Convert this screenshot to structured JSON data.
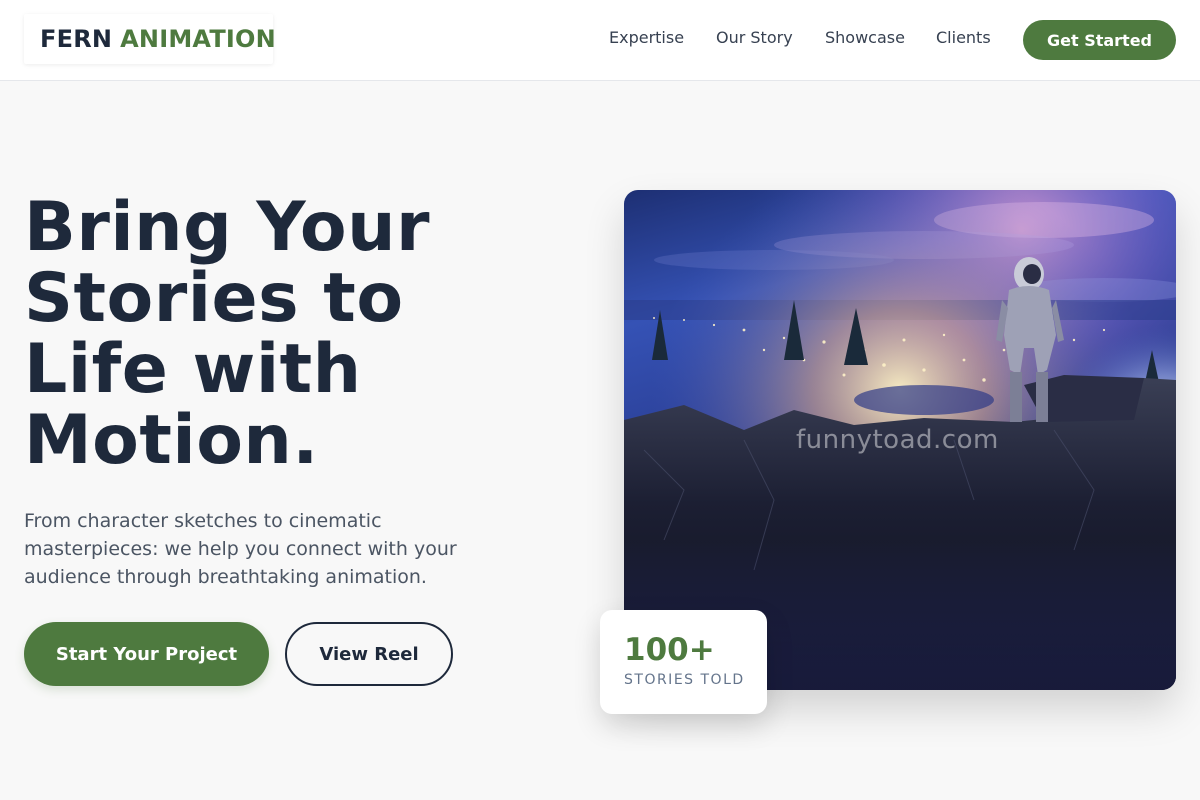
{
  "brand": {
    "name_primary": "FERN",
    "name_accent": "ANIMATION",
    "accent_color": "#4e7a3f",
    "text_color": "#1e293b"
  },
  "nav": {
    "links": [
      "Expertise",
      "Our Story",
      "Showcase",
      "Clients"
    ],
    "cta": "Get Started"
  },
  "hero": {
    "title": "Bring Your Stories to Life with Motion.",
    "subtitle": "From character sketches to cinematic masterpieces: we help you connect with your audience through breathtaking animation.",
    "primary_button": "Start Your Project",
    "secondary_button": "View Reel"
  },
  "image": {
    "watermark": "funnytoad.com"
  },
  "stat": {
    "number": "100+",
    "label": "STORIES TOLD"
  }
}
